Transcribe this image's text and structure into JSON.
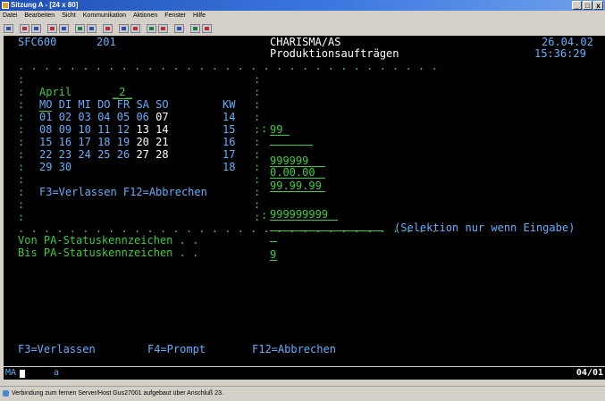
{
  "window": {
    "title": "Sitzung A - [24 x 80]",
    "buttons": [
      "_",
      "□",
      "x"
    ]
  },
  "menu": [
    "Datei",
    "Bearbeiten",
    "Sicht",
    "Kommunikation",
    "Aktionen",
    "Fenster",
    "Hilfe"
  ],
  "toolbar": {
    "icons": [
      "print-screen-icon",
      "copy-icon",
      "paste-icon",
      "send-icon",
      "receive-icon",
      "display-icon",
      "color-icon",
      "map-icon",
      "keypad-icon",
      "record-macro-icon",
      "play-macro-icon",
      "stop-macro-icon",
      "help-icon",
      "run-icon",
      "edit-icon"
    ]
  },
  "terminal": {
    "program": "SFC600",
    "number": "201",
    "app": "CHARISMA/AS",
    "subtitle": "Produktionsaufträgen",
    "date": "26.04.02",
    "time": "15:36:29",
    "calendar": {
      "month": "April",
      "day": "2",
      "headers": [
        "MO",
        "DI",
        "MI",
        "DO",
        "FR",
        "SA",
        "SO",
        "KW"
      ],
      "weeks": [
        {
          "days": [
            "01",
            "02",
            "03",
            "04",
            "05",
            "06",
            "07"
          ],
          "kw": "14"
        },
        {
          "days": [
            "08",
            "09",
            "10",
            "11",
            "12",
            "13",
            "14"
          ],
          "kw": "15"
        },
        {
          "days": [
            "15",
            "16",
            "17",
            "18",
            "19",
            "20",
            "21"
          ],
          "kw": "16"
        },
        {
          "days": [
            "22",
            "23",
            "24",
            "25",
            "26",
            "27",
            "28"
          ],
          "kw": "17"
        },
        {
          "days": [
            "29",
            "30",
            "",
            "",
            "",
            "",
            ""
          ],
          "kw": "18"
        }
      ],
      "keys": "F3=Verlassen F12=Abbrechen"
    },
    "fields": {
      "f1": "99",
      "f2": "999999",
      "f3": "0.00.00",
      "f4": "99.99.99",
      "f5": "999999999",
      "f9": "9"
    },
    "selection_hint": "(Selektion nur wenn Eingabe)",
    "von_label": "Von PA-Statuskennzeichen . .",
    "bis_label": "Bis PA-Statuskennzeichen . .",
    "fkeys": {
      "f3": "F3=Verlassen",
      "f4": "F4=Prompt",
      "f12": "F12=Abbrechen"
    },
    "status_left": "MA",
    "status_mid": "a",
    "status_pos": "04/01"
  },
  "statusbar": {
    "text": "Verbindung zum fernen Server/Host Gus27001 aufgebaut über Anschluß 23."
  },
  "colors": {
    "terminal_bg": "#000000",
    "green": "#35d035",
    "white": "#ffffff",
    "blue": "#60b0ff",
    "titlebar": "#1f4fb5"
  }
}
